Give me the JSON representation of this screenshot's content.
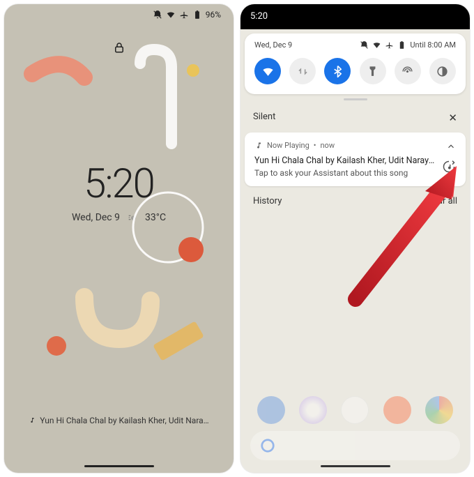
{
  "left": {
    "status": {
      "battery": "96%"
    },
    "time": "5:20",
    "date": "Wed, Dec 9",
    "temp": "33°C",
    "now_playing": "Yun Hi Chala Chal by Kailash Kher, Udit Nara…"
  },
  "right": {
    "time": "5:20",
    "qs_date": "Wed, Dec 9",
    "alarm": "Until 8:00 AM",
    "tiles": [
      {
        "name": "wifi",
        "on": true
      },
      {
        "name": "mobile-data",
        "on": false
      },
      {
        "name": "bluetooth",
        "on": true
      },
      {
        "name": "flashlight",
        "on": false
      },
      {
        "name": "hotspot",
        "on": false
      },
      {
        "name": "dark-theme",
        "on": false
      }
    ],
    "section_label": "Silent",
    "notification": {
      "app": "Now Playing",
      "when": "now",
      "title": "Yun Hi Chala Chal by Kailash Kher, Udit Narayan & H…",
      "subtitle": "Tap to ask your Assistant about this song"
    },
    "history": "History",
    "clear_all": "Clear all"
  },
  "colors": {
    "accent": "#1a73e8",
    "arrow": "#d8232a"
  }
}
